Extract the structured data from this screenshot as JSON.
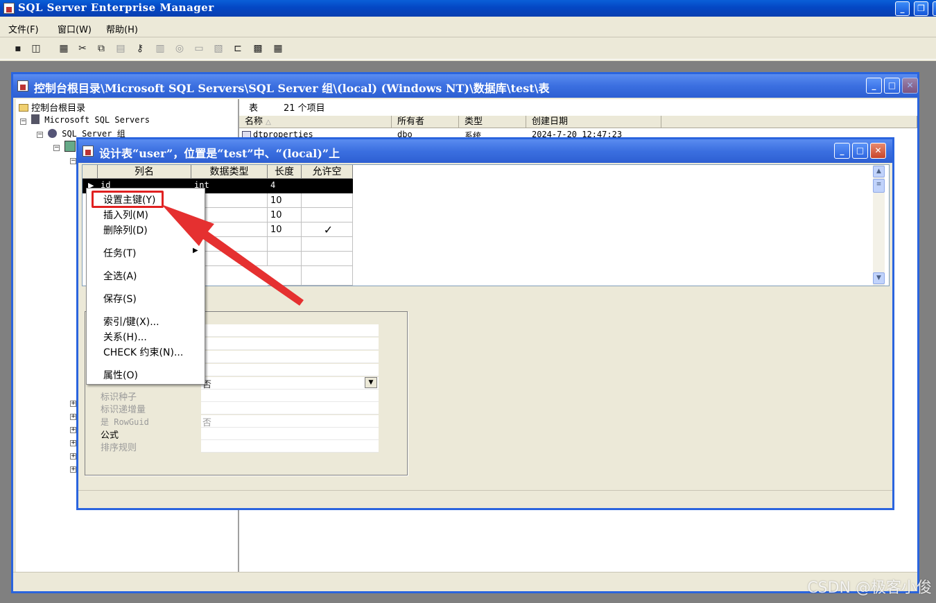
{
  "app": {
    "title": "SQL Server Enterprise Manager"
  },
  "menu": {
    "items": [
      "文件(F)",
      "窗口(W)",
      "帮助(H)"
    ]
  },
  "console": {
    "title": "控制台根目录\\Microsoft SQL Servers\\SQL Server 组\\(local) (Windows NT)\\数据库\\test\\表",
    "tree": {
      "root": "控制台根目录",
      "servers": "Microsoft SQL Servers",
      "group": "SQL Server 组"
    },
    "list": {
      "table_label": "表",
      "count_label": "21 个项目",
      "columns": [
        "名称",
        "所有者",
        "类型",
        "创建日期"
      ],
      "rows": [
        {
          "name": "dtproperties",
          "owner": "dbo",
          "type": "系统",
          "created": "2024-7-20 12:47:23"
        }
      ]
    }
  },
  "design": {
    "title": "设计表“user”，位置是“test”中、“(local)”上",
    "columns": [
      "列名",
      "数据类型",
      "长度",
      "允许空"
    ],
    "rows": [
      {
        "name": "id",
        "type": "int",
        "length": "4",
        "nullable": ""
      },
      {
        "name": "",
        "type": "ar",
        "length": "10",
        "nullable": ""
      },
      {
        "name": "",
        "type": "ar",
        "length": "10",
        "nullable": ""
      },
      {
        "name": "",
        "type": "ar",
        "length": "10",
        "nullable": "✓"
      }
    ],
    "properties": {
      "default_label": "否",
      "seed_label": "标识种子",
      "inc_label": "标识递增量",
      "rowguid_label": "是 RowGuid",
      "rowguid_value": "否",
      "formula_label": "公式",
      "collation_label": "排序规则"
    }
  },
  "context_menu": {
    "set_pk": "设置主键(Y)",
    "insert_col": "插入列(M)",
    "delete_col": "删除列(D)",
    "tasks": "任务(T)",
    "select_all": "全选(A)",
    "save": "保存(S)",
    "indexes": "索引/键(X)...",
    "relations": "关系(H)...",
    "check": "CHECK 约束(N)...",
    "props": "属性(O)"
  },
  "watermark": "CSDN @极客小俊"
}
